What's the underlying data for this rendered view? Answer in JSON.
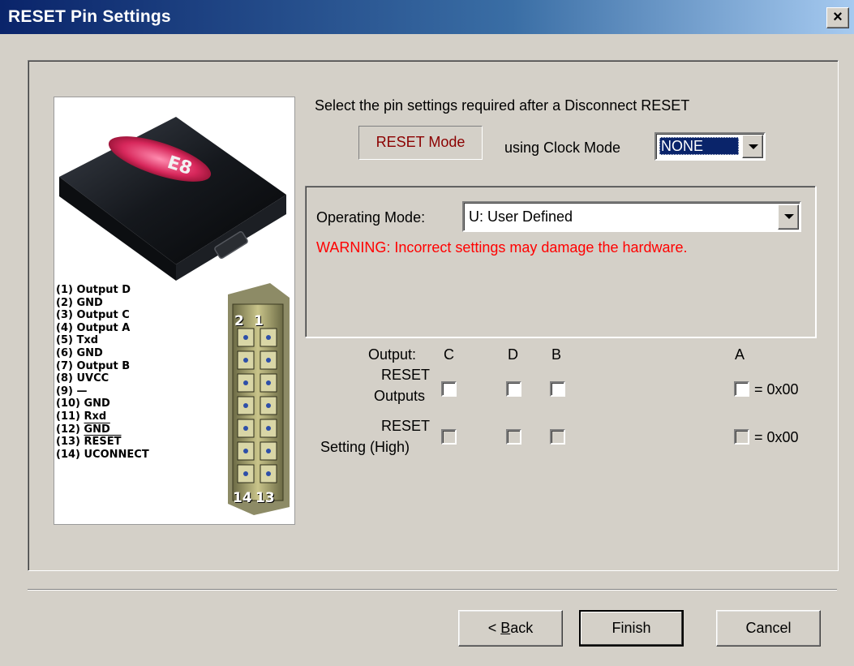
{
  "window": {
    "title": "RESET Pin Settings",
    "close_glyph": "×"
  },
  "illustration": {
    "pin_labels": [
      "(1) Output D",
      "(2) GND",
      "(3) Output C",
      "(4) Output A",
      "(5) Txd",
      "(6) GND",
      "(7) Output B",
      "(8) UVCC",
      "(9) —",
      "(10) GND",
      "(11) Rxd",
      "(12) GND",
      "(13) RESET",
      "(14) UCONNECT"
    ],
    "connector_top_labels": [
      "2",
      "1"
    ],
    "connector_bottom_labels": [
      "14",
      "13"
    ],
    "device_badge": "E8"
  },
  "main": {
    "instruction": "Select the pin settings required after a Disconnect RESET",
    "reset_mode_label": "RESET Mode",
    "using_clock_label": "using Clock Mode",
    "clock_mode_value": "NONE"
  },
  "operating": {
    "label": "Operating Mode:",
    "value": "U: User Defined",
    "warning": "WARNING: Incorrect settings may damage the hardware."
  },
  "grid": {
    "output_label": "Output:",
    "columns": [
      "C",
      "D",
      "B",
      "A"
    ],
    "row1_label_line1": "RESET",
    "row1_label_line2": "Outputs",
    "row2_label_line1": "RESET",
    "row2_label_line2": "Setting (High)",
    "row1_value": "= 0x00",
    "row2_value": "= 0x00"
  },
  "buttons": {
    "back_prefix": "< ",
    "back_access": "B",
    "back_rest": "ack",
    "finish": "Finish",
    "cancel": "Cancel"
  },
  "colors": {
    "title_start": "#0a246a",
    "title_end": "#a6caf0",
    "warning": "#ff0000",
    "reset_mode": "#8b0000",
    "face": "#d4d0c8"
  }
}
